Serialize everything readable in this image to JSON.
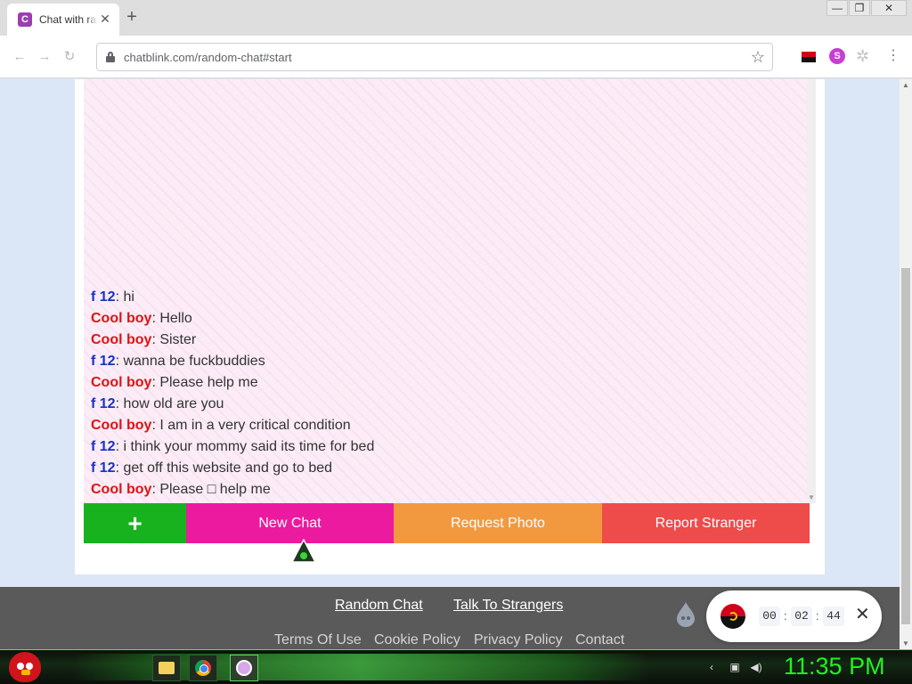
{
  "browser": {
    "tab_title": "Chat with random strangers",
    "tab_favicon": "C",
    "url": "chatblink.com/random-chat#start",
    "window_controls": {
      "minimize": "—",
      "restore": "❐",
      "close": "✕"
    },
    "extension_s": "S"
  },
  "chat": {
    "messages": [
      {
        "nick": "f 12",
        "color": "blue",
        "text": ": hi"
      },
      {
        "nick": "Cool boy",
        "color": "red",
        "text": ": Hello"
      },
      {
        "nick": "Cool boy",
        "color": "red",
        "text": ": Sister"
      },
      {
        "nick": "f 12",
        "color": "blue",
        "text": ": wanna be fuckbuddies"
      },
      {
        "nick": "Cool boy",
        "color": "red",
        "text": ": Please help me"
      },
      {
        "nick": "f 12",
        "color": "blue",
        "text": ": how old are you"
      },
      {
        "nick": "Cool boy",
        "color": "red",
        "text": ": I am in a very critical condition"
      },
      {
        "nick": "f 12",
        "color": "blue",
        "text": ": i think your mommy said its time for bed"
      },
      {
        "nick": "f 12",
        "color": "blue",
        "text": ": get off this website and go to bed"
      },
      {
        "nick": "Cool boy",
        "color": "red",
        "text": ": Please □ help me"
      }
    ],
    "actions": {
      "add_label": "+",
      "new_chat_label": "New Chat",
      "request_photo_label": "Request Photo",
      "report_label": "Report Stranger"
    }
  },
  "footer": {
    "links_top": [
      "Random Chat",
      "Talk To Strangers"
    ],
    "links_bottom": [
      "Terms Of Use",
      "Cookie Policy",
      "Privacy Policy",
      "Contact"
    ]
  },
  "timer": {
    "hours": "00",
    "minutes": "02",
    "seconds": "44",
    "close": "✕"
  },
  "taskbar": {
    "clock": "11:35 PM"
  },
  "colors": {
    "nick_blue": "#1733c4",
    "nick_red": "#dd1313",
    "add_green": "#18b21f",
    "new_chat_pink": "#ec1a9e",
    "photo_orange": "#f2993f",
    "report_red": "#ee4b4b"
  }
}
